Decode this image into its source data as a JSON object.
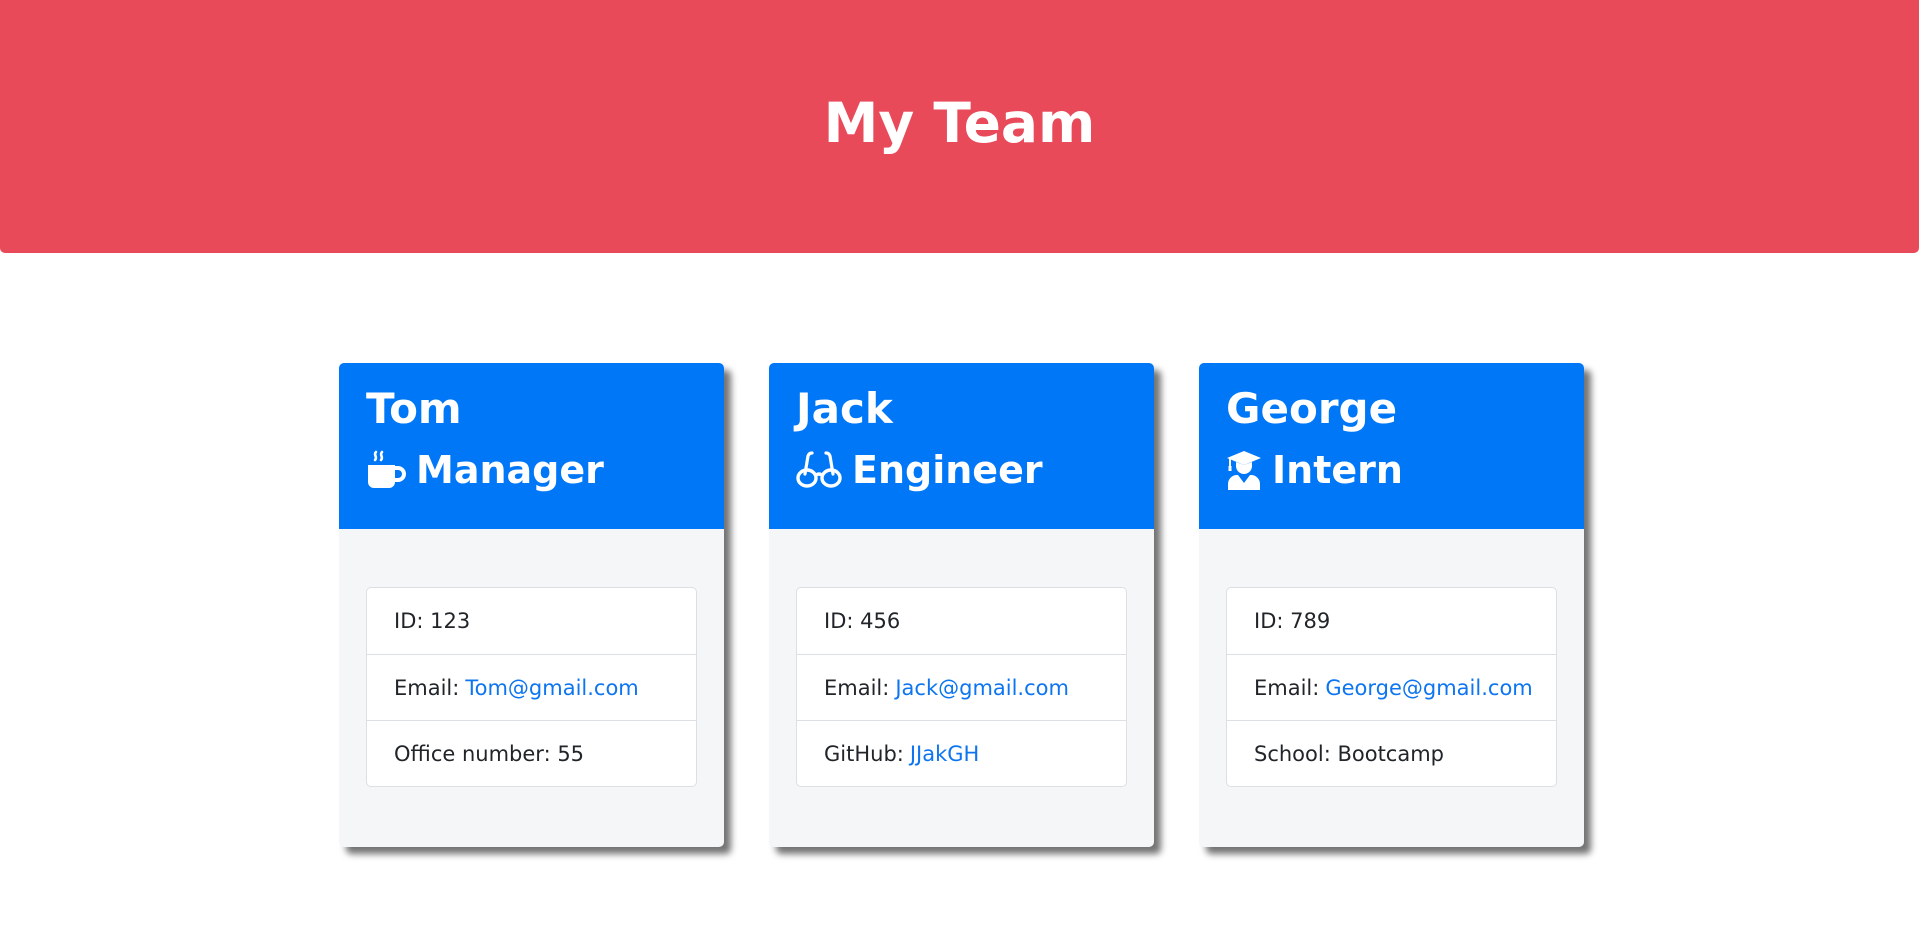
{
  "header": {
    "title": "My Team"
  },
  "colors": {
    "header_bg": "#e84a5a",
    "card_header_bg": "#0077f7",
    "link": "#0d75f0",
    "card_body_bg": "#f5f6f8"
  },
  "cards": [
    {
      "name": "Tom",
      "role": "Manager",
      "icon": "mug-hot-icon",
      "id_text": "ID: 123",
      "email_label": "Email:",
      "email": "Tom@gmail.com",
      "extra_text": "Office number: 55"
    },
    {
      "name": "Jack",
      "role": "Engineer",
      "icon": "glasses-icon",
      "id_text": "ID: 456",
      "email_label": "Email:",
      "email": "Jack@gmail.com",
      "extra_label": "GitHub:",
      "extra_link": "JJakGH"
    },
    {
      "name": "George",
      "role": "Intern",
      "icon": "user-graduate-icon",
      "id_text": "ID: 789",
      "email_label": "Email:",
      "email": "George@gmail.com",
      "extra_text": "School: Bootcamp"
    }
  ]
}
